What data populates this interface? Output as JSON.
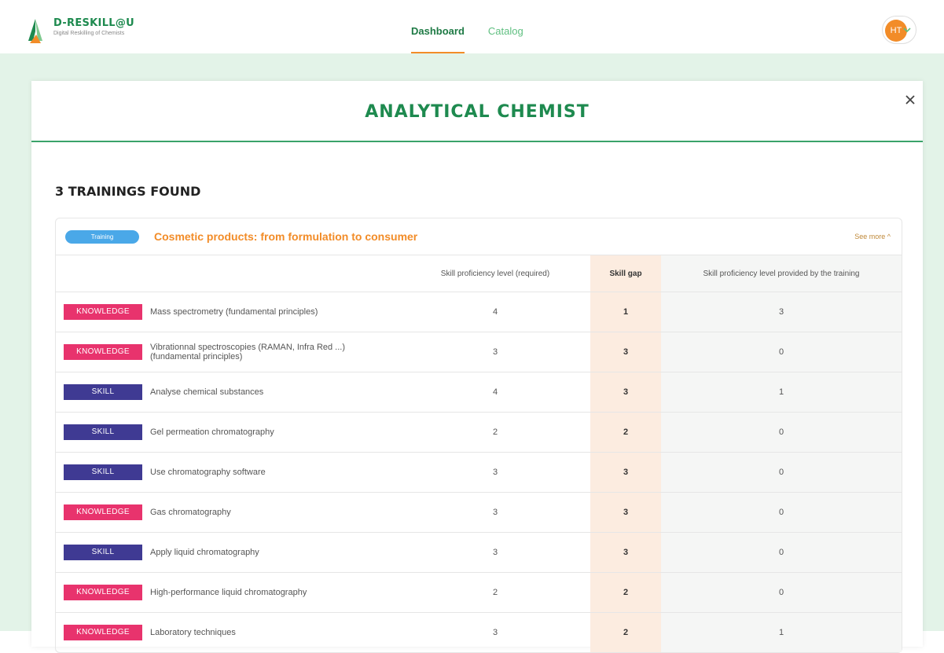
{
  "brand": {
    "title": "D-RESKILL@U",
    "subtitle": "Digital Reskilling of Chemists"
  },
  "nav": {
    "items": [
      {
        "label": "Dashboard",
        "active": true
      },
      {
        "label": "Catalog",
        "active": false
      }
    ]
  },
  "user": {
    "initials": "HT"
  },
  "modal": {
    "title": "ANALYTICAL CHEMIST",
    "found_label": "3 TRAININGS FOUND"
  },
  "training": {
    "badge": "Training",
    "title": "Cosmetic products: from formulation to consumer",
    "see_more": "See more",
    "columns": [
      "",
      "Skill proficiency level (required)",
      "Skill gap",
      "Skill proficiency level provided by the training"
    ],
    "rows": [
      {
        "type": "KNOWLEDGE",
        "name": "Mass spectrometry (fundamental principles)",
        "required": "4",
        "gap": "1",
        "provided": "3"
      },
      {
        "type": "KNOWLEDGE",
        "name": "Vibrationnal spectroscopies (RAMAN, Infra Red ...) (fundamental principles)",
        "required": "3",
        "gap": "3",
        "provided": "0"
      },
      {
        "type": "SKILL",
        "name": "Analyse chemical substances",
        "required": "4",
        "gap": "3",
        "provided": "1"
      },
      {
        "type": "SKILL",
        "name": "Gel permeation chromatography",
        "required": "2",
        "gap": "2",
        "provided": "0"
      },
      {
        "type": "SKILL",
        "name": "Use chromatography software",
        "required": "3",
        "gap": "3",
        "provided": "0"
      },
      {
        "type": "KNOWLEDGE",
        "name": "Gas chromatography",
        "required": "3",
        "gap": "3",
        "provided": "0"
      },
      {
        "type": "SKILL",
        "name": "Apply liquid chromatography",
        "required": "3",
        "gap": "3",
        "provided": "0"
      },
      {
        "type": "KNOWLEDGE",
        "name": "High-performance liquid chromatography",
        "required": "2",
        "gap": "2",
        "provided": "0"
      },
      {
        "type": "KNOWLEDGE",
        "name": "Laboratory techniques",
        "required": "3",
        "gap": "2",
        "provided": "1"
      }
    ]
  },
  "colors": {
    "brand_green": "#1e8a4f",
    "accent_orange": "#f28c28",
    "knowledge": "#e8336d",
    "skill": "#3f3a93",
    "gap_bg": "#fcece0",
    "band_bg": "#e3f3e8"
  }
}
